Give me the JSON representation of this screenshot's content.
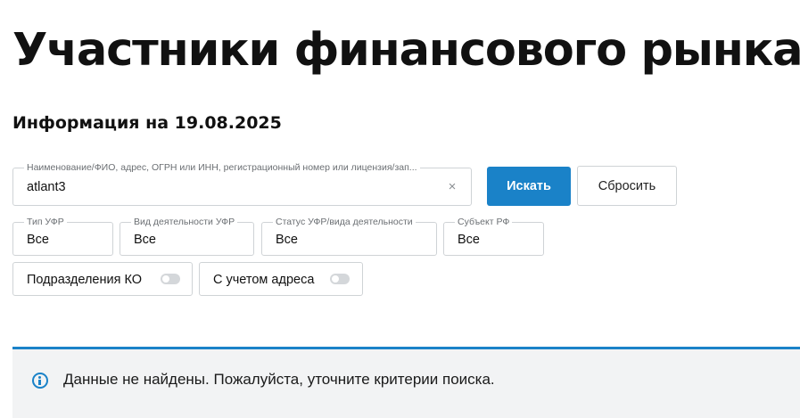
{
  "page": {
    "title": "Участники финансового рынка",
    "info_date": "Информация на 19.08.2025"
  },
  "search": {
    "label": "Наименование/ФИО, адрес, ОГРН или ИНН, регистрационный номер или лицензия/зап...",
    "value": "atlant3",
    "clear_symbol": "×"
  },
  "buttons": {
    "search_label": "Искать",
    "reset_label": "Сбросить"
  },
  "filters": [
    {
      "label": "Тип УФР",
      "value": "Все"
    },
    {
      "label": "Вид деятельности УФР",
      "value": "Все"
    },
    {
      "label": "Статус УФР/вида деятельности",
      "value": "Все"
    },
    {
      "label": "Субъект РФ",
      "value": "Все"
    }
  ],
  "toggles": [
    {
      "label": "Подразделения КО",
      "state": "off"
    },
    {
      "label": "С учетом адреса",
      "state": "off"
    }
  ],
  "notice": {
    "icon": "info-icon",
    "text": "Данные не найдены. Пожалуйста, уточните критерии поиска."
  },
  "colors": {
    "accent": "#1a82c8",
    "notice_background": "#f2f3f4",
    "border": "#cfd3d6"
  }
}
